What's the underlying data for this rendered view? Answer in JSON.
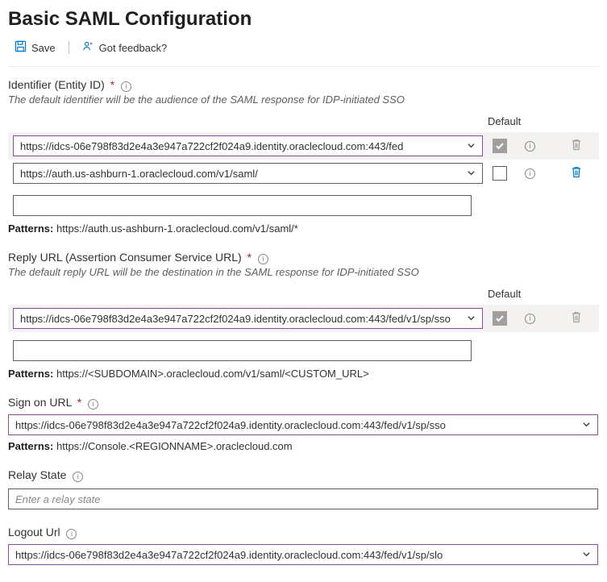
{
  "header": {
    "title": "Basic SAML Configuration",
    "save_label": "Save",
    "feedback_label": "Got feedback?"
  },
  "identifier": {
    "label": "Identifier (Entity ID)",
    "helper": "The default identifier will be the audience of the SAML response for IDP-initiated SSO",
    "default_col": "Default",
    "rows": [
      "https://idcs-06e798f83d2e4a3e947a722cf2f024a9.identity.oraclecloud.com:443/fed",
      "https://auth.us-ashburn-1.oraclecloud.com/v1/saml/"
    ],
    "patterns_label": "Patterns:",
    "patterns_value": "https://auth.us-ashburn-1.oraclecloud.com/v1/saml/*"
  },
  "reply": {
    "label": "Reply URL (Assertion Consumer Service URL)",
    "helper": "The default reply URL will be the destination in the SAML response for IDP-initiated SSO",
    "default_col": "Default",
    "rows": [
      "https://idcs-06e798f83d2e4a3e947a722cf2f024a9.identity.oraclecloud.com:443/fed/v1/sp/sso"
    ],
    "patterns_label": "Patterns:",
    "patterns_value": "https://<SUBDOMAIN>.oraclecloud.com/v1/saml/<CUSTOM_URL>"
  },
  "signon": {
    "label": "Sign on URL",
    "value": "https://idcs-06e798f83d2e4a3e947a722cf2f024a9.identity.oraclecloud.com:443/fed/v1/sp/sso",
    "patterns_label": "Patterns:",
    "patterns_value": "https://Console.<REGIONNAME>.oraclecloud.com"
  },
  "relay": {
    "label": "Relay State",
    "placeholder": "Enter a relay state"
  },
  "logout": {
    "label": "Logout Url",
    "value": "https://idcs-06e798f83d2e4a3e947a722cf2f024a9.identity.oraclecloud.com:443/fed/v1/sp/slo"
  }
}
